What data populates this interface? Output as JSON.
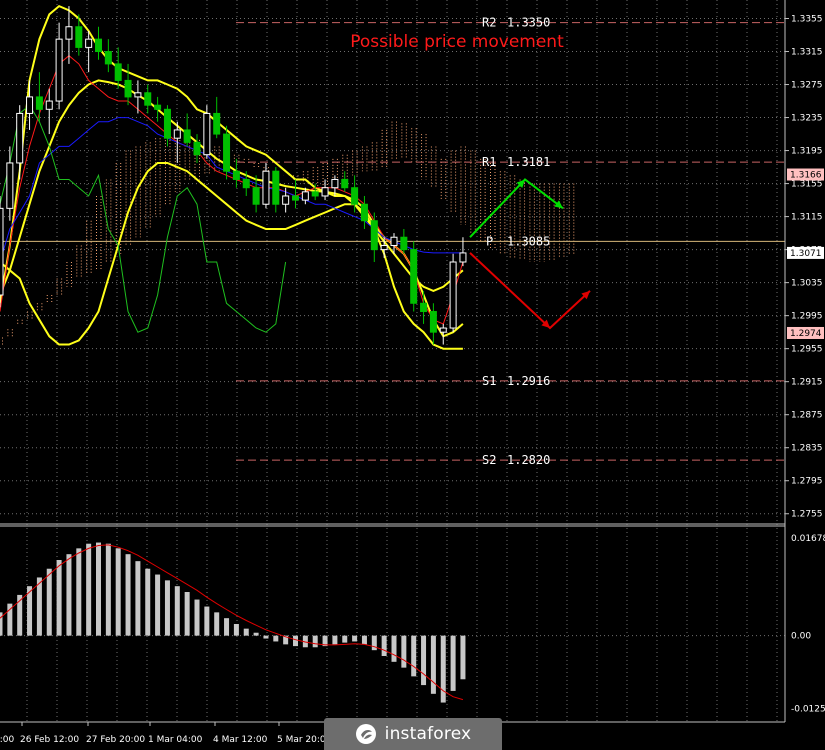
{
  "title": "Possible price movement",
  "colors": {
    "background": "#000000",
    "grid": "#6f6f6f",
    "title": "#ff1a1a",
    "candle_bull": "#ffffff",
    "candle_bear": "#00c000",
    "bollinger": "#ffff1a",
    "tenkan": "#ff1a1a",
    "kijun": "#1a1aff",
    "chikou": "#1fc01f",
    "kumo": "#f0a070",
    "level_line": "#c86464",
    "pivot_line": "#d6b678",
    "arrow_up": "#00e000",
    "arrow_down": "#e00000",
    "histogram": "#c8c8c8",
    "signal": "#e00000"
  },
  "levels": [
    {
      "name": "R2",
      "value": "1.3350"
    },
    {
      "name": "R1",
      "value": "1.3181"
    },
    {
      "name": "P",
      "value": "1.3085"
    },
    {
      "name": "S1",
      "value": "1.2916"
    },
    {
      "name": "S2",
      "value": "1.2820"
    }
  ],
  "price_axis": [
    "1.3355",
    "1.3315",
    "1.3275",
    "1.3235",
    "1.3195",
    "1.3155",
    "1.3115",
    "1.3075",
    "1.3035",
    "1.2995",
    "1.2955",
    "1.2915",
    "1.2875",
    "1.2835",
    "1.2795",
    "1.2755"
  ],
  "price_markers": [
    {
      "value": "1.3166",
      "color": "#ffc0c0"
    },
    {
      "value": "1.3071",
      "color": "#ffffff"
    },
    {
      "value": "1.2974",
      "color": "#ffc0c0"
    }
  ],
  "macd_axis": [
    "0.01678",
    "0.00",
    "-0.01253"
  ],
  "time_axis": [
    "0:00",
    "26 Feb 12:00",
    "27 Feb 20:00",
    "1 Mar 04:00",
    "4 Mar 12:00",
    "5 Mar 20:00"
  ],
  "logo": {
    "text": "instaforex",
    "icon": "instaforex-logo-icon"
  },
  "chart_data": {
    "type": "candlestick",
    "title": "Possible price movement",
    "xlabel": "",
    "ylabel": "",
    "ylim": [
      1.2745,
      1.3375
    ],
    "grid": true,
    "candles": [
      [
        1.302,
        1.314,
        1.3005,
        1.3125
      ],
      [
        1.3125,
        1.32,
        1.311,
        1.318
      ],
      [
        1.318,
        1.325,
        1.316,
        1.324
      ],
      [
        1.324,
        1.328,
        1.322,
        1.326
      ],
      [
        1.326,
        1.329,
        1.323,
        1.3245
      ],
      [
        1.3245,
        1.327,
        1.3215,
        1.3255
      ],
      [
        1.3255,
        1.335,
        1.3245,
        1.333
      ],
      [
        1.333,
        1.337,
        1.33,
        1.3345
      ],
      [
        1.3345,
        1.336,
        1.331,
        1.332
      ],
      [
        1.332,
        1.334,
        1.329,
        1.333
      ],
      [
        1.333,
        1.3345,
        1.3305,
        1.3315
      ],
      [
        1.3315,
        1.333,
        1.329,
        1.33
      ],
      [
        1.33,
        1.332,
        1.327,
        1.328
      ],
      [
        1.328,
        1.33,
        1.325,
        1.326
      ],
      [
        1.326,
        1.328,
        1.324,
        1.3265
      ],
      [
        1.3265,
        1.3275,
        1.324,
        1.325
      ],
      [
        1.325,
        1.326,
        1.323,
        1.3245
      ],
      [
        1.3245,
        1.325,
        1.32,
        1.321
      ],
      [
        1.321,
        1.323,
        1.318,
        1.322
      ],
      [
        1.322,
        1.324,
        1.32,
        1.3205
      ],
      [
        1.3205,
        1.3215,
        1.318,
        1.319
      ],
      [
        1.319,
        1.325,
        1.3185,
        1.324
      ],
      [
        1.324,
        1.326,
        1.321,
        1.3215
      ],
      [
        1.3215,
        1.3225,
        1.316,
        1.317
      ],
      [
        1.317,
        1.3185,
        1.315,
        1.316
      ],
      [
        1.316,
        1.317,
        1.314,
        1.315
      ],
      [
        1.315,
        1.3165,
        1.312,
        1.313
      ],
      [
        1.313,
        1.318,
        1.3125,
        1.317
      ],
      [
        1.317,
        1.3175,
        1.312,
        1.313
      ],
      [
        1.313,
        1.315,
        1.312,
        1.314
      ],
      [
        1.314,
        1.316,
        1.3125,
        1.3135
      ],
      [
        1.3135,
        1.315,
        1.313,
        1.3145
      ],
      [
        1.3145,
        1.3155,
        1.3135,
        1.314
      ],
      [
        1.314,
        1.316,
        1.3135,
        1.315
      ],
      [
        1.315,
        1.3165,
        1.314,
        1.316
      ],
      [
        1.316,
        1.317,
        1.3145,
        1.315
      ],
      [
        1.315,
        1.3165,
        1.312,
        1.313
      ],
      [
        1.313,
        1.314,
        1.31,
        1.311
      ],
      [
        1.311,
        1.312,
        1.306,
        1.3075
      ],
      [
        1.3075,
        1.309,
        1.3065,
        1.308
      ],
      [
        1.308,
        1.3095,
        1.307,
        1.309
      ],
      [
        1.309,
        1.31,
        1.307,
        1.3075
      ],
      [
        1.3075,
        1.3085,
        1.3,
        1.301
      ],
      [
        1.301,
        1.3025,
        1.2985,
        1.3
      ],
      [
        1.3,
        1.301,
        1.296,
        1.2975
      ],
      [
        1.2975,
        1.2985,
        1.296,
        1.298
      ],
      [
        1.298,
        1.307,
        1.2975,
        1.306
      ],
      [
        1.306,
        1.309,
        1.3055,
        1.3071
      ]
    ],
    "levels": {
      "R2": 1.335,
      "R1": 1.3181,
      "P": 1.3085,
      "S1": 1.2916,
      "S2": 1.282
    },
    "series": [
      {
        "values": [
          1.301,
          1.308,
          1.317,
          1.328,
          1.333,
          1.336,
          1.337,
          1.3365,
          1.3355,
          1.334,
          1.332,
          1.3305,
          1.3295,
          1.329,
          1.3285,
          1.328,
          1.328,
          1.3275,
          1.327,
          1.326,
          1.3245,
          1.324,
          1.323,
          1.322,
          1.321,
          1.32,
          1.3195,
          1.319,
          1.318,
          1.317,
          1.316,
          1.316,
          1.315,
          1.3145,
          1.314,
          1.314,
          1.3135,
          1.3125,
          1.3105,
          1.309,
          1.308,
          1.307,
          1.305,
          1.302,
          1.299,
          1.297,
          1.2975,
          1.2985
        ]
      },
      {
        "values": [
          1.302,
          1.305,
          1.309,
          1.313,
          1.317,
          1.32,
          1.323,
          1.325,
          1.3265,
          1.3275,
          1.328,
          1.3278,
          1.3275,
          1.327,
          1.3262,
          1.3255,
          1.3245,
          1.3235,
          1.3225,
          1.3215,
          1.3205,
          1.3195,
          1.3185,
          1.3178,
          1.317,
          1.3165,
          1.316,
          1.3158,
          1.3155,
          1.3152,
          1.315,
          1.3148,
          1.3146,
          1.3145,
          1.3143,
          1.314,
          1.313,
          1.3115,
          1.31,
          1.3085,
          1.307,
          1.3055,
          1.304,
          1.303,
          1.3025,
          1.303,
          1.304,
          1.305
        ]
      },
      {
        "values": [
          1.306,
          1.305,
          1.304,
          1.301,
          1.299,
          1.297,
          1.296,
          1.296,
          1.2965,
          1.298,
          1.3,
          1.304,
          1.308,
          1.312,
          1.315,
          1.317,
          1.318,
          1.318,
          1.3175,
          1.317,
          1.316,
          1.315,
          1.314,
          1.313,
          1.312,
          1.311,
          1.3105,
          1.31,
          1.31,
          1.31,
          1.3105,
          1.311,
          1.3115,
          1.312,
          1.3125,
          1.313,
          1.313,
          1.312,
          1.31,
          1.307,
          1.303,
          1.3,
          1.2985,
          1.2975,
          1.296,
          1.2955,
          1.2955,
          1.2955
        ]
      },
      {
        "values": [
          1.3,
          1.308,
          1.315,
          1.32,
          1.324,
          1.327,
          1.33,
          1.331,
          1.33,
          1.328,
          1.327,
          1.326,
          1.3255,
          1.3255,
          1.3245,
          1.3235,
          1.3225,
          1.3215,
          1.3205,
          1.32,
          1.3195,
          1.318,
          1.317,
          1.3165,
          1.316,
          1.3155,
          1.315,
          1.315,
          1.315,
          1.3145,
          1.314,
          1.3145,
          1.315,
          1.315,
          1.315,
          1.3145,
          1.314,
          1.313,
          1.311,
          1.309,
          1.308,
          1.307,
          1.305,
          1.301,
          1.299,
          1.2985,
          1.302,
          1.306
        ]
      },
      {
        "values": [
          1.306,
          1.31,
          1.312,
          1.314,
          1.318,
          1.319,
          1.32,
          1.32,
          1.321,
          1.322,
          1.323,
          1.323,
          1.3235,
          1.3235,
          1.323,
          1.3225,
          1.3215,
          1.321,
          1.3205,
          1.32,
          1.3195,
          1.319,
          1.3175,
          1.317,
          1.3165,
          1.316,
          1.3155,
          1.315,
          1.3148,
          1.3145,
          1.314,
          1.3135,
          1.313,
          1.313,
          1.3125,
          1.312,
          1.3115,
          1.311,
          1.31,
          1.309,
          1.3085,
          1.308,
          1.3075,
          1.3072,
          1.3071,
          1.3071,
          1.3071,
          1.3071
        ]
      },
      {
        "values": [
          1.313,
          1.318,
          1.324,
          1.325,
          1.323,
          1.32,
          1.316,
          1.316,
          1.315,
          1.314,
          1.3165,
          1.31,
          1.308,
          1.3,
          1.2975,
          1.298,
          1.302,
          1.309,
          1.314,
          1.315,
          1.313,
          1.306,
          1.306,
          1.301,
          1.3,
          1.299,
          1.298,
          1.2975,
          1.2985,
          1.306
        ]
      },
      {
        "values": [
          1.296,
          1.297,
          1.299,
          1.3,
          1.301,
          1.302,
          1.304,
          1.306,
          1.308,
          1.311,
          1.314,
          1.316,
          1.318,
          1.3195,
          1.32,
          1.3205,
          1.321,
          1.3215,
          1.3215,
          1.3212,
          1.3208,
          1.3205,
          1.32,
          1.3195,
          1.319,
          1.3185,
          1.318,
          1.3175,
          1.317,
          1.3165,
          1.3165,
          1.317,
          1.3175,
          1.318,
          1.3185,
          1.319,
          1.3195,
          1.32,
          1.3205,
          1.322,
          1.323,
          1.3228,
          1.3222,
          1.3215,
          1.32,
          1.3185,
          1.3195,
          1.32,
          1.3195,
          1.3185,
          1.318,
          1.317,
          1.3165,
          1.316,
          1.3155,
          1.3155,
          1.3155,
          1.3155,
          1.3155
        ]
      },
      {
        "values": [
          1.297,
          1.298,
          1.2985,
          1.299,
          1.3,
          1.301,
          1.302,
          1.303,
          1.304,
          1.3045,
          1.305,
          1.306,
          1.307,
          1.308,
          1.309,
          1.31,
          1.3115,
          1.313,
          1.3145,
          1.316,
          1.316,
          1.3165,
          1.317,
          1.3175,
          1.318,
          1.318,
          1.3175,
          1.317,
          1.317,
          1.3165,
          1.316,
          1.3155,
          1.315,
          1.315,
          1.3155,
          1.316,
          1.3165,
          1.317,
          1.317,
          1.3175,
          1.3185,
          1.3185,
          1.318,
          1.316,
          1.315,
          1.3135,
          1.312,
          1.3105,
          1.3095,
          1.3085,
          1.3075,
          1.307,
          1.3065,
          1.3062,
          1.306,
          1.306,
          1.3062,
          1.3065,
          1.307
        ]
      }
    ],
    "projection": {
      "up": [
        [
          1.309,
          1.316,
          1.3125
        ]
      ],
      "down": [
        [
          1.3071,
          1.298,
          1.3025
        ]
      ]
    },
    "macd": {
      "ylim": [
        -0.0145,
        0.0185
      ],
      "histogram": [
        0.004,
        0.0055,
        0.007,
        0.0085,
        0.01,
        0.0115,
        0.013,
        0.014,
        0.015,
        0.0158,
        0.016,
        0.0158,
        0.015,
        0.014,
        0.0128,
        0.0115,
        0.0105,
        0.0095,
        0.0085,
        0.0075,
        0.0062,
        0.005,
        0.004,
        0.003,
        0.002,
        0.0012,
        0.0005,
        -0.0005,
        -0.001,
        -0.0015,
        -0.0018,
        -0.002,
        -0.002,
        -0.0018,
        -0.0015,
        -0.0012,
        -0.001,
        -0.0015,
        -0.0025,
        -0.0035,
        -0.0045,
        -0.0055,
        -0.007,
        -0.0085,
        -0.01,
        -0.0115,
        -0.0095,
        -0.0075
      ],
      "signal": [
        0.003,
        0.0045,
        0.006,
        0.0075,
        0.009,
        0.0105,
        0.012,
        0.0132,
        0.0142,
        0.015,
        0.0155,
        0.0156,
        0.0152,
        0.0146,
        0.0138,
        0.0128,
        0.0118,
        0.0108,
        0.0098,
        0.0088,
        0.0078,
        0.0066,
        0.0055,
        0.0045,
        0.0035,
        0.0026,
        0.0018,
        0.001,
        0.0004,
        -0.0002,
        -0.0007,
        -0.0011,
        -0.0014,
        -0.0016,
        -0.0016,
        -0.0015,
        -0.0014,
        -0.0015,
        -0.0019,
        -0.0025,
        -0.0033,
        -0.0042,
        -0.0053,
        -0.0066,
        -0.008,
        -0.0095,
        -0.0105,
        -0.011
      ]
    }
  }
}
